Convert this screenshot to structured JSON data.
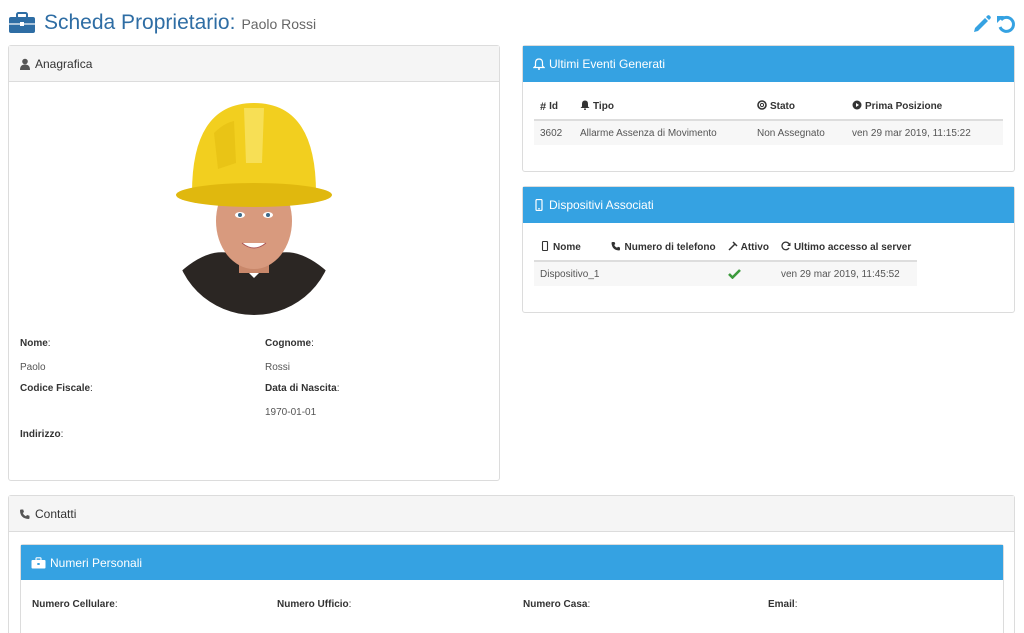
{
  "header": {
    "title": "Scheda Proprietario:",
    "owner_name": "Paolo Rossi"
  },
  "anagrafica": {
    "heading": "Anagrafica",
    "fields": {
      "nome_label": "Nome",
      "nome_value": "Paolo",
      "cognome_label": "Cognome",
      "cognome_value": "Rossi",
      "codice_fiscale_label": "Codice Fiscale",
      "data_nascita_label": "Data di Nascita",
      "data_nascita_value": "1970-01-01",
      "indirizzo_label": "Indirizzo"
    }
  },
  "eventi": {
    "heading": "Ultimi Eventi Generati",
    "columns": [
      "Id",
      "Tipo",
      "Stato",
      "Prima Posizione"
    ],
    "rows": [
      {
        "id": "3602",
        "tipo": "Allarme Assenza di Movimento",
        "stato": "Non Assegnato",
        "prima_posizione": "ven 29 mar 2019, 11:15:22"
      }
    ]
  },
  "dispositivi": {
    "heading": "Dispositivi Associati",
    "columns": [
      "Nome",
      "Numero di telefono",
      "Attivo",
      "Ultimo accesso al server"
    ],
    "rows": [
      {
        "nome": "Dispositivo_1",
        "telefono": "",
        "attivo": true,
        "ultimo_accesso": "ven 29 mar 2019, 11:45:52"
      }
    ]
  },
  "contatti": {
    "heading": "Contatti",
    "numeri_personali": {
      "heading": "Numeri Personali",
      "labels": [
        "Numero Cellulare",
        "Numero Ufficio",
        "Numero Casa",
        "Email"
      ]
    }
  },
  "colors": {
    "accent": "#35a2e2",
    "title": "#2e6da4",
    "link": "#2a7ab8",
    "check": "#3c9a3c"
  },
  "icons": {
    "title": "briefcase-icon",
    "edit": "pencil-icon",
    "undo": "undo-icon",
    "anagrafica": "user-icon",
    "eventi": "bell-icon",
    "dispositivi": "mobile-icon",
    "contatti": "phone-icon",
    "numeri_personali": "briefcase-icon"
  }
}
